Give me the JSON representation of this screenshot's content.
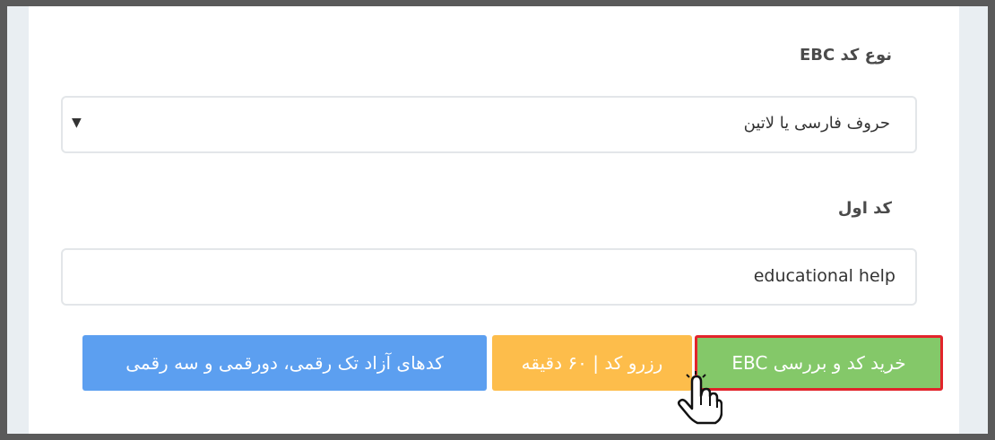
{
  "form": {
    "code_type_label": "نوع کد EBC",
    "code_type_selected": "حروف فارسی یا لاتین",
    "first_code_label": "کد اول",
    "first_code_value": "educational help"
  },
  "buttons": {
    "buy_check": "خرید کد و بررسی EBC",
    "reserve": "رزرو کد | ۶۰ دقیقه",
    "free_codes": "کدهای آزاد تک رقمی، دورقمی و سه رقمی"
  },
  "colors": {
    "green": "#84c869",
    "yellow": "#fdbd4b",
    "blue": "#5c9ff0",
    "highlight_border": "#e2242b"
  },
  "icons": {
    "select_caret": "caret-down-icon",
    "cursor": "hand-pointer-icon"
  }
}
